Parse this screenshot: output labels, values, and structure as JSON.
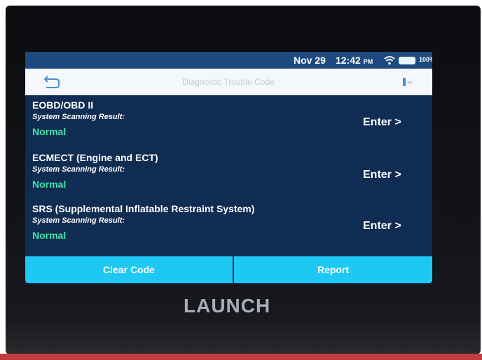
{
  "status_bar": {
    "date": "Nov 29",
    "time": "12:42",
    "ampm": "PM",
    "battery": "100%"
  },
  "nav": {
    "title": "Diagnostic Trouble Code"
  },
  "systems": [
    {
      "name": "EOBD/OBD II",
      "scan_label": "System Scanning Result:",
      "status": "Normal",
      "action": "Enter >"
    },
    {
      "name": "ECMECT (Engine and ECT)",
      "scan_label": "System Scanning Result:",
      "status": "Normal",
      "action": "Enter >"
    },
    {
      "name": "SRS (Supplemental Inflatable Restraint System)",
      "scan_label": "System Scanning Result:",
      "status": "Normal",
      "action": "Enter >"
    }
  ],
  "buttons": {
    "clear_code": "Clear Code",
    "report": "Report"
  },
  "brand": "LAUNCH",
  "colors": {
    "status_bar": "#1c4a80",
    "screen_bg": "#0f2c52",
    "normal_status": "#3fe4a8",
    "button": "#1ec8f2"
  },
  "icons": [
    "back-icon",
    "wifi-icon",
    "battery-icon",
    "more-icon"
  ]
}
